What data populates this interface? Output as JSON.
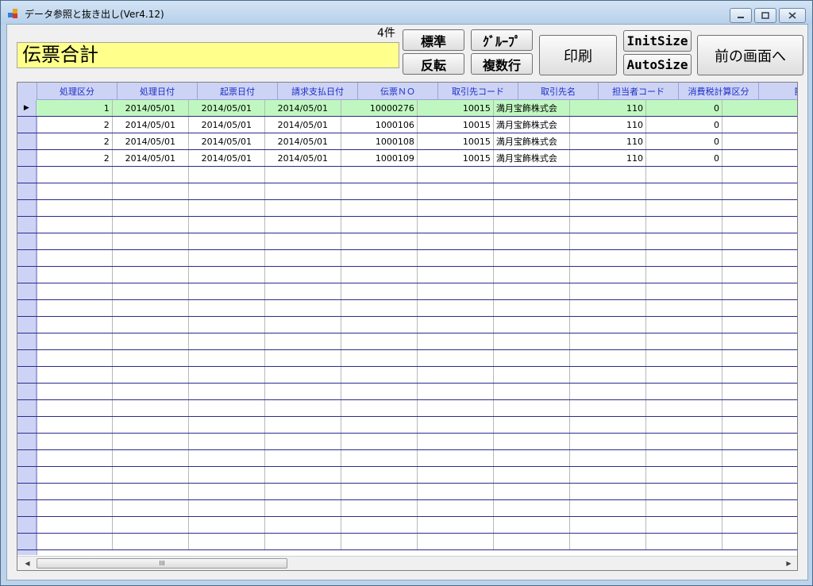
{
  "window": {
    "title": "データ参照と抜き出し(Ver4.12)"
  },
  "header": {
    "record_count": "4件",
    "title_box": "伝票合計"
  },
  "buttons": {
    "standard": "標準",
    "group": "ｸﾞﾙｰﾌﾟ",
    "invert": "反転",
    "multi_row": "複数行",
    "print": "印刷",
    "init_size": "InitSize",
    "auto_size": "AutoSize",
    "back": "前の画面へ"
  },
  "grid": {
    "columns": [
      "処理区分",
      "処理日付",
      "起票日付",
      "請求支払日付",
      "伝票ＮＯ",
      "取引先コード",
      "取引先名",
      "担当者コード",
      "消費税計算区分",
      "節"
    ],
    "rows": [
      [
        "1",
        "2014/05/01",
        "2014/05/01",
        "2014/05/01",
        "10000276",
        "10015",
        "満月宝飾株式会",
        "110",
        "0",
        ""
      ],
      [
        "2",
        "2014/05/01",
        "2014/05/01",
        "2014/05/01",
        "1000106",
        "10015",
        "満月宝飾株式会",
        "110",
        "0",
        ""
      ],
      [
        "2",
        "2014/05/01",
        "2014/05/01",
        "2014/05/01",
        "1000108",
        "10015",
        "満月宝飾株式会",
        "110",
        "0",
        ""
      ],
      [
        "2",
        "2014/05/01",
        "2014/05/01",
        "2014/05/01",
        "1000109",
        "10015",
        "満月宝飾株式会",
        "110",
        "0",
        ""
      ]
    ],
    "selected_row_marker": "▶",
    "selected_row_color": "#c0f7c0",
    "header_text_color": "#1d2fc7"
  },
  "scrollbar": {
    "left_arrow": "◀",
    "right_arrow": "▶",
    "thumb_grip": "III"
  },
  "icons": {
    "app": "app-window-icon",
    "minimize": "minimize-icon",
    "maximize": "maximize-icon",
    "close": "close-icon"
  }
}
